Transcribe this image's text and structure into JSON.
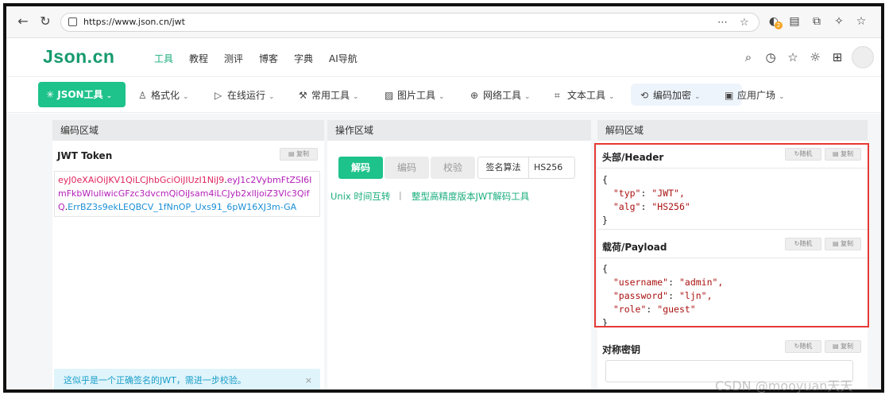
{
  "browser": {
    "url": "https://www.json.cn/jwt",
    "tab_badge": "2"
  },
  "site": {
    "logo": "Json.cn",
    "nav": [
      "工具",
      "教程",
      "测评",
      "博客",
      "字典",
      "AI导航"
    ]
  },
  "toolbar": {
    "primary": "JSON工具",
    "items": [
      "格式化",
      "在线运行",
      "常用工具",
      "图片工具",
      "网络工具",
      "文本工具",
      "编码加密",
      "应用广场"
    ]
  },
  "encode_panel": {
    "title": "编码区域",
    "section_label": "JWT Token",
    "copy_label": "复制",
    "token_header": "eyJ0eXAiOiJKV1QiLCJhbGciOiJIUzI1NiJ9",
    "token_payload": "eyJ1c2VybmFtZSI6ImFkbWluIiwicGFzc3dvcmQiOiJsam4iLCJyb2xlIjoiZ3Vlc3QifQ",
    "token_signature": "ErrBZ3s9ekLEQBCV_1fNnOP_Uxs91_6pW16XJ3m-GA",
    "alert": "这似乎是一个正确签名的JWT，需进一步校验。",
    "alert_close": "×"
  },
  "operate_panel": {
    "title": "操作区域",
    "decode_btn": "解码",
    "encode_btn": "编码",
    "verify_btn": "校验",
    "algo_label": "签名算法",
    "algo_value": "HS256",
    "link_unix": "Unix 时间互转",
    "link_separator": "|",
    "link_jwt": "整型高精度版本JWT解码工具"
  },
  "decode_panel": {
    "title": "解码区域",
    "header_label": "头部/Header",
    "payload_label": "载荷/Payload",
    "secret_label": "对称密钥",
    "random_label": "随机",
    "copy_label": "复制",
    "header_json": {
      "open": "{",
      "close": "}",
      "lines": [
        {
          "key": "\"typ\"",
          "value": "\"JWT\","
        },
        {
          "key": "\"alg\"",
          "value": "\"HS256\""
        }
      ]
    },
    "payload_json": {
      "open": "{",
      "close": "}",
      "lines": [
        {
          "key": "\"username\"",
          "value": "\"admin\","
        },
        {
          "key": "\"password\"",
          "value": "\"ljn\","
        },
        {
          "key": "\"role\"",
          "value": "\"guest\""
        }
      ]
    }
  },
  "watermark": "CSDN @mooyuan天天"
}
